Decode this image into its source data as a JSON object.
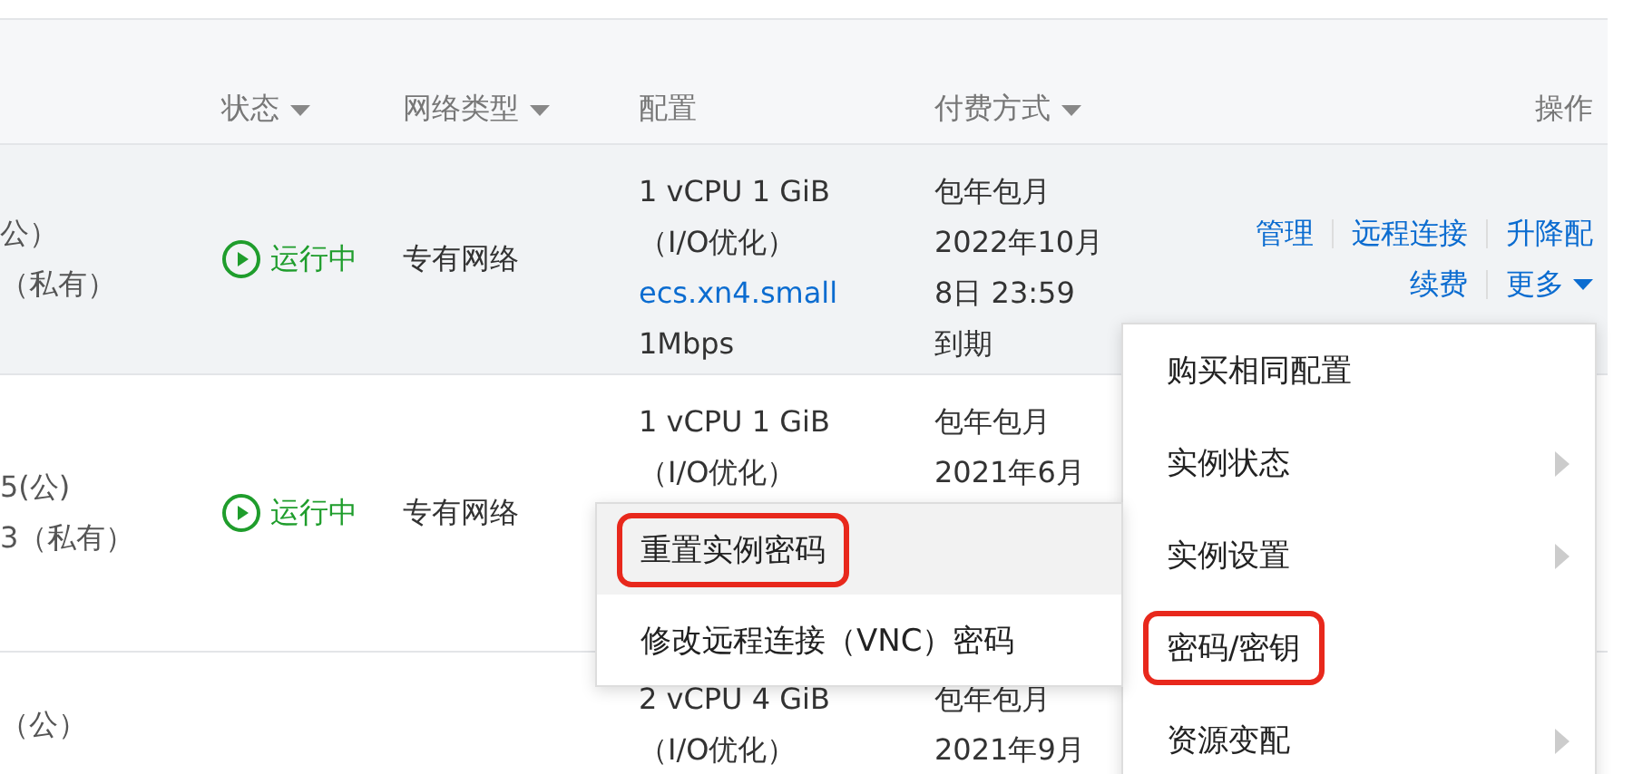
{
  "table": {
    "columns": [
      {
        "label": "状态",
        "sortable": true
      },
      {
        "label": "网络类型",
        "sortable": true
      },
      {
        "label": "配置",
        "sortable": false
      },
      {
        "label": "付费方式",
        "sortable": true
      },
      {
        "label": "操作",
        "sortable": false
      }
    ],
    "rows": [
      {
        "hovered": true,
        "address_lines": [
          "公）",
          "（私有）"
        ],
        "status": "运行中",
        "network": "专有网络",
        "config": [
          {
            "text": "1 vCPU 1 GiB",
            "kind": "text"
          },
          {
            "text": "（I/O优化）",
            "kind": "text"
          },
          {
            "text": "ecs.xn4.small",
            "kind": "link"
          },
          {
            "text": "1Mbps",
            "kind": "text"
          }
        ],
        "payment": [
          "包年包月",
          "2022年10月",
          "8日 23:59",
          "到期"
        ],
        "actions": [
          [
            "管理",
            "远程连接",
            "升降配"
          ],
          [
            "续费",
            "更多"
          ]
        ]
      },
      {
        "hovered": false,
        "address_lines": [
          "5(公)",
          "3（私有）"
        ],
        "status": "运行中",
        "network": "专有网络",
        "config": [
          {
            "text": "1 vCPU 1 GiB",
            "kind": "text"
          },
          {
            "text": "（I/O优化）",
            "kind": "text"
          }
        ],
        "payment": [
          "包年包月",
          "2021年6月"
        ],
        "actions": []
      },
      {
        "hovered": false,
        "address_lines": [
          "（公）"
        ],
        "status": "",
        "network": "",
        "config": [
          {
            "text": "2 vCPU 4 GiB",
            "kind": "text"
          },
          {
            "text": "（I/O优化）",
            "kind": "text"
          }
        ],
        "payment": [
          "包年包月",
          "2021年9月"
        ],
        "actions": []
      }
    ]
  },
  "more_menu": {
    "items": [
      {
        "label": "购买相同配置",
        "submenu": false,
        "highlighted": false
      },
      {
        "label": "实例状态",
        "submenu": true,
        "highlighted": false
      },
      {
        "label": "实例设置",
        "submenu": true,
        "highlighted": false
      },
      {
        "label": "密码/密钥",
        "submenu": false,
        "highlighted": true
      },
      {
        "label": "资源变配",
        "submenu": true,
        "highlighted": false
      }
    ]
  },
  "submenu": {
    "items": [
      {
        "label": "重置实例密码",
        "hovered": true,
        "highlighted": true
      },
      {
        "label": "修改远程连接（VNC）密码",
        "hovered": false,
        "highlighted": false
      }
    ]
  }
}
